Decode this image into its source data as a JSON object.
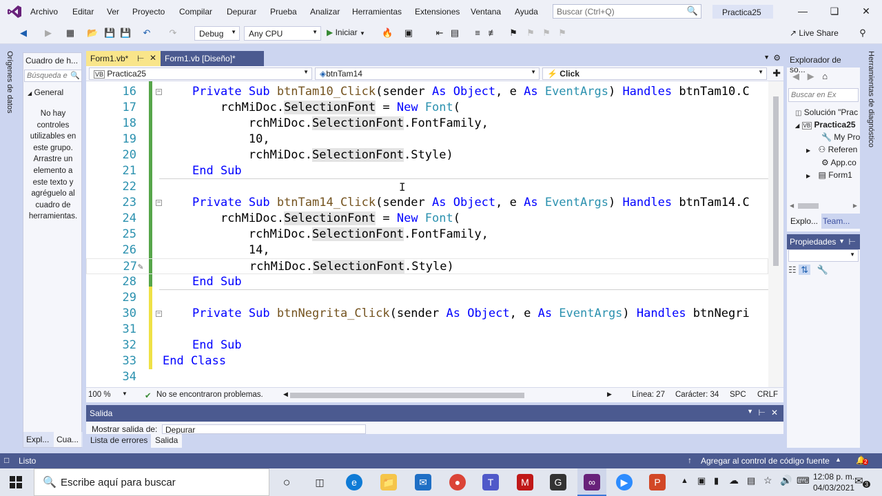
{
  "menu": {
    "items": [
      "Archivo",
      "Editar",
      "Ver",
      "Proyecto",
      "Compilar",
      "Depurar",
      "Prueba",
      "Analizar",
      "Herramientas",
      "Extensiones",
      "Ventana",
      "Ayuda"
    ],
    "search_placeholder": "Buscar (Ctrl+Q)",
    "solution_name": "Practica25"
  },
  "toolbar": {
    "config": "Debug",
    "platform": "Any CPU",
    "start_label": "Iniciar",
    "live_share": "Live Share"
  },
  "left_strip": {
    "label": "Orígenes de datos"
  },
  "toolbox": {
    "title": "Cuadro de h...",
    "search_placeholder": "Búsqueda e",
    "group": "General",
    "empty_message": "No hay controles utilizables en este grupo. Arrastre un elemento a este texto y agréguelo al cuadro de herramientas.",
    "tabs": [
      "Expl...",
      "Cua..."
    ]
  },
  "doc_tabs": [
    {
      "label": "Form1.vb*"
    },
    {
      "label": "Form1.vb [Diseño]*"
    }
  ],
  "nav": {
    "project": "Practica25",
    "object": "btnTam14",
    "event": "Click"
  },
  "code_lines": [
    {
      "n": "16"
    },
    {
      "n": "17"
    },
    {
      "n": "18"
    },
    {
      "n": "19"
    },
    {
      "n": "20"
    },
    {
      "n": "21"
    },
    {
      "n": "22"
    },
    {
      "n": "23"
    },
    {
      "n": "24"
    },
    {
      "n": "25"
    },
    {
      "n": "26"
    },
    {
      "n": "27"
    },
    {
      "n": "28"
    },
    {
      "n": "29"
    },
    {
      "n": "30"
    },
    {
      "n": "31"
    },
    {
      "n": "32"
    },
    {
      "n": "33"
    },
    {
      "n": "34"
    }
  ],
  "code_text": {
    "l16_a": "Private Sub ",
    "l16_b": "btnTam10_Click",
    "l16_c": "(sender ",
    "l16_d": "As ",
    "l16_e": "Object",
    "l16_f": ", e ",
    "l16_g": "As ",
    "l16_h": "EventArgs",
    "l16_i": ") ",
    "l16_j": "Handles ",
    "l16_k": "btnTam10.C",
    "l17_a": "    rchMiDoc.",
    "l17_b": "SelectionFont",
    "l17_c": " = ",
    "l17_d": "New ",
    "l17_e": "Font",
    "l17_f": "(",
    "l18_a": "        rchMiDoc.",
    "l18_b": "SelectionFont",
    "l18_c": ".FontFamily,",
    "l19": "        10,",
    "l20_a": "        rchMiDoc.",
    "l20_b": "SelectionFont",
    "l20_c": ".Style)",
    "l21": "End Sub",
    "l23_a": "Private Sub ",
    "l23_b": "btnTam14_Click",
    "l23_c": "(sender ",
    "l23_d": "As ",
    "l23_e": "Object",
    "l23_f": ", e ",
    "l23_g": "As ",
    "l23_h": "EventArgs",
    "l23_i": ") ",
    "l23_j": "Handles ",
    "l23_k": "btnTam14.C",
    "l24_a": "    rchMiDoc.",
    "l24_b": "SelectionFont",
    "l24_c": " = ",
    "l24_d": "New ",
    "l24_e": "Font",
    "l24_f": "(",
    "l25_a": "        rchMiDoc.",
    "l25_b": "SelectionFont",
    "l25_c": ".FontFamily,",
    "l26": "        14,",
    "l27_a": "        rchMiDoc.",
    "l27_b": "SelectionFont",
    "l27_c": ".Style)",
    "l28": "End Sub",
    "l30_a": "Private Sub ",
    "l30_b": "btnNegrita_Click",
    "l30_c": "(sender ",
    "l30_d": "As ",
    "l30_e": "Object",
    "l30_f": ", e ",
    "l30_g": "As ",
    "l30_h": "EventArgs",
    "l30_i": ") ",
    "l30_j": "Handles ",
    "l30_k": "btnNegri",
    "l32": "End Sub",
    "l33": "End Class"
  },
  "editor_status": {
    "zoom": "100 %",
    "issues": "No se encontraron problemas.",
    "line": "Línea: 27",
    "char": "Carácter: 34",
    "spc": "SPC",
    "crlf": "CRLF"
  },
  "solution_explorer": {
    "title": "Explorador de so...",
    "search_placeholder": "Buscar en Ex",
    "items": [
      "Solución \"Prac",
      "Practica25",
      "My Pro",
      "Referen",
      "App.co",
      "Form1"
    ],
    "tabs": [
      "Explo...",
      "Team..."
    ]
  },
  "properties": {
    "title": "Propiedades"
  },
  "right_strip": {
    "label": "Herramientas de diagnóstico"
  },
  "output": {
    "title": "Salida",
    "show_from_label": "Mostrar salida de:",
    "show_from_value": "Depurar",
    "tabs": [
      "Lista de errores",
      "Salida"
    ]
  },
  "statusbar": {
    "ready": "Listo",
    "source_control": "Agregar al control de código fuente",
    "notifications": "2"
  },
  "taskbar": {
    "search_placeholder": "Escribe aquí para buscar",
    "time": "12:08 p. m.",
    "date": "04/03/2021",
    "notif_count": "3"
  },
  "colors": {
    "accent": "#68217a",
    "title_bar": "#eef0f7",
    "status_bar": "#4b5a90",
    "keyword": "#0000ff",
    "type": "#2b91af"
  }
}
